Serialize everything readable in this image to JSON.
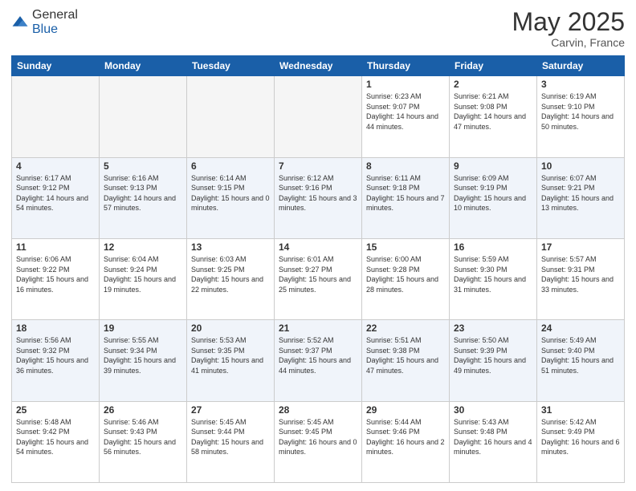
{
  "header": {
    "logo_general": "General",
    "logo_blue": "Blue",
    "month": "May 2025",
    "location": "Carvin, France"
  },
  "days_of_week": [
    "Sunday",
    "Monday",
    "Tuesday",
    "Wednesday",
    "Thursday",
    "Friday",
    "Saturday"
  ],
  "rows": [
    [
      {
        "day": "",
        "empty": true
      },
      {
        "day": "",
        "empty": true
      },
      {
        "day": "",
        "empty": true
      },
      {
        "day": "",
        "empty": true
      },
      {
        "day": "1",
        "sunrise": "6:23 AM",
        "sunset": "9:07 PM",
        "daylight": "14 hours and 44 minutes."
      },
      {
        "day": "2",
        "sunrise": "6:21 AM",
        "sunset": "9:08 PM",
        "daylight": "14 hours and 47 minutes."
      },
      {
        "day": "3",
        "sunrise": "6:19 AM",
        "sunset": "9:10 PM",
        "daylight": "14 hours and 50 minutes."
      }
    ],
    [
      {
        "day": "4",
        "sunrise": "6:17 AM",
        "sunset": "9:12 PM",
        "daylight": "14 hours and 54 minutes."
      },
      {
        "day": "5",
        "sunrise": "6:16 AM",
        "sunset": "9:13 PM",
        "daylight": "14 hours and 57 minutes."
      },
      {
        "day": "6",
        "sunrise": "6:14 AM",
        "sunset": "9:15 PM",
        "daylight": "15 hours and 0 minutes."
      },
      {
        "day": "7",
        "sunrise": "6:12 AM",
        "sunset": "9:16 PM",
        "daylight": "15 hours and 3 minutes."
      },
      {
        "day": "8",
        "sunrise": "6:11 AM",
        "sunset": "9:18 PM",
        "daylight": "15 hours and 7 minutes."
      },
      {
        "day": "9",
        "sunrise": "6:09 AM",
        "sunset": "9:19 PM",
        "daylight": "15 hours and 10 minutes."
      },
      {
        "day": "10",
        "sunrise": "6:07 AM",
        "sunset": "9:21 PM",
        "daylight": "15 hours and 13 minutes."
      }
    ],
    [
      {
        "day": "11",
        "sunrise": "6:06 AM",
        "sunset": "9:22 PM",
        "daylight": "15 hours and 16 minutes."
      },
      {
        "day": "12",
        "sunrise": "6:04 AM",
        "sunset": "9:24 PM",
        "daylight": "15 hours and 19 minutes."
      },
      {
        "day": "13",
        "sunrise": "6:03 AM",
        "sunset": "9:25 PM",
        "daylight": "15 hours and 22 minutes."
      },
      {
        "day": "14",
        "sunrise": "6:01 AM",
        "sunset": "9:27 PM",
        "daylight": "15 hours and 25 minutes."
      },
      {
        "day": "15",
        "sunrise": "6:00 AM",
        "sunset": "9:28 PM",
        "daylight": "15 hours and 28 minutes."
      },
      {
        "day": "16",
        "sunrise": "5:59 AM",
        "sunset": "9:30 PM",
        "daylight": "15 hours and 31 minutes."
      },
      {
        "day": "17",
        "sunrise": "5:57 AM",
        "sunset": "9:31 PM",
        "daylight": "15 hours and 33 minutes."
      }
    ],
    [
      {
        "day": "18",
        "sunrise": "5:56 AM",
        "sunset": "9:32 PM",
        "daylight": "15 hours and 36 minutes."
      },
      {
        "day": "19",
        "sunrise": "5:55 AM",
        "sunset": "9:34 PM",
        "daylight": "15 hours and 39 minutes."
      },
      {
        "day": "20",
        "sunrise": "5:53 AM",
        "sunset": "9:35 PM",
        "daylight": "15 hours and 41 minutes."
      },
      {
        "day": "21",
        "sunrise": "5:52 AM",
        "sunset": "9:37 PM",
        "daylight": "15 hours and 44 minutes."
      },
      {
        "day": "22",
        "sunrise": "5:51 AM",
        "sunset": "9:38 PM",
        "daylight": "15 hours and 47 minutes."
      },
      {
        "day": "23",
        "sunrise": "5:50 AM",
        "sunset": "9:39 PM",
        "daylight": "15 hours and 49 minutes."
      },
      {
        "day": "24",
        "sunrise": "5:49 AM",
        "sunset": "9:40 PM",
        "daylight": "15 hours and 51 minutes."
      }
    ],
    [
      {
        "day": "25",
        "sunrise": "5:48 AM",
        "sunset": "9:42 PM",
        "daylight": "15 hours and 54 minutes."
      },
      {
        "day": "26",
        "sunrise": "5:46 AM",
        "sunset": "9:43 PM",
        "daylight": "15 hours and 56 minutes."
      },
      {
        "day": "27",
        "sunrise": "5:45 AM",
        "sunset": "9:44 PM",
        "daylight": "15 hours and 58 minutes."
      },
      {
        "day": "28",
        "sunrise": "5:45 AM",
        "sunset": "9:45 PM",
        "daylight": "16 hours and 0 minutes."
      },
      {
        "day": "29",
        "sunrise": "5:44 AM",
        "sunset": "9:46 PM",
        "daylight": "16 hours and 2 minutes."
      },
      {
        "day": "30",
        "sunrise": "5:43 AM",
        "sunset": "9:48 PM",
        "daylight": "16 hours and 4 minutes."
      },
      {
        "day": "31",
        "sunrise": "5:42 AM",
        "sunset": "9:49 PM",
        "daylight": "16 hours and 6 minutes."
      }
    ]
  ]
}
